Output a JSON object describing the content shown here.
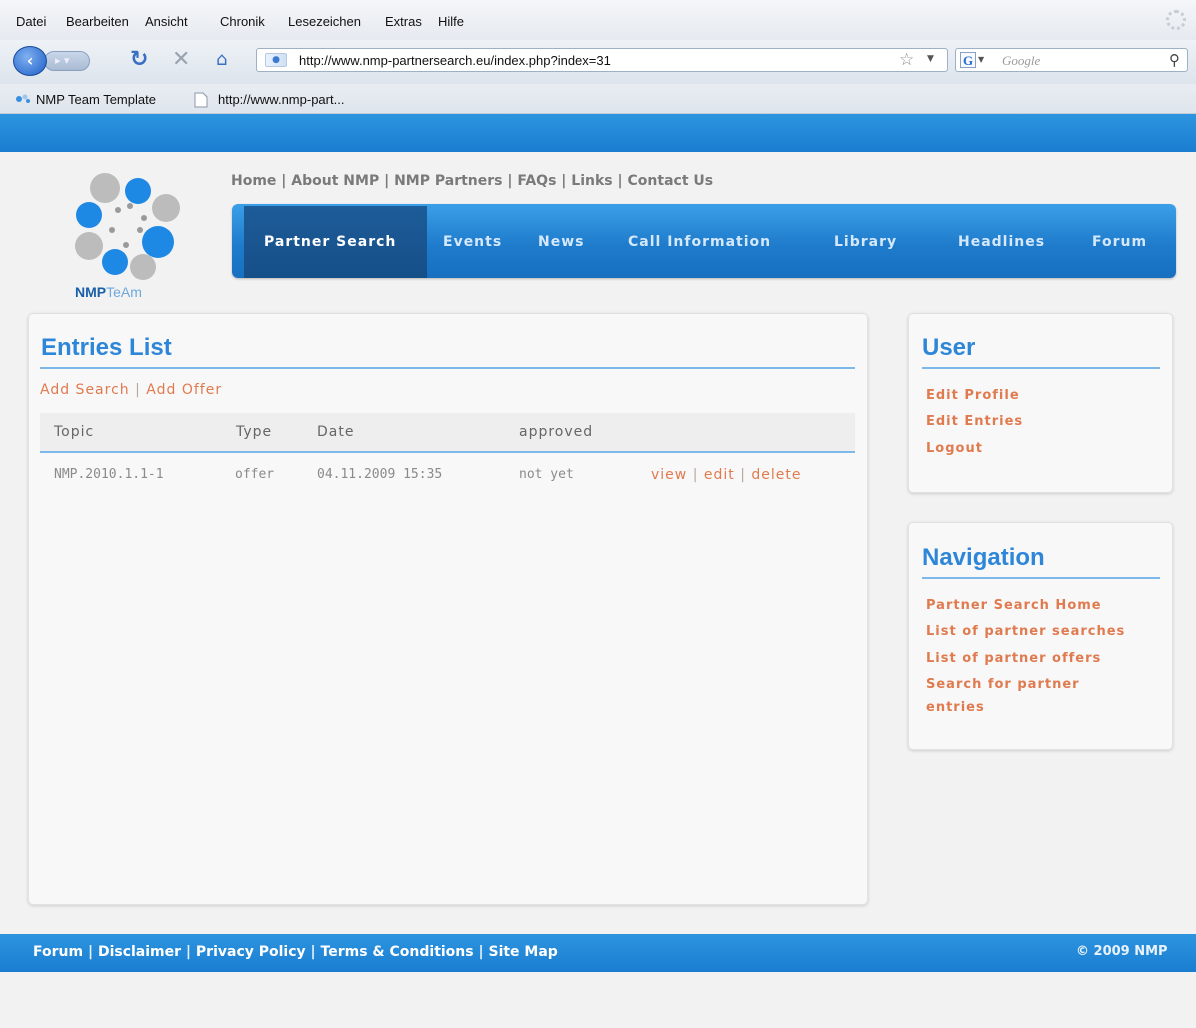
{
  "browser": {
    "menu": [
      "Datei",
      "Bearbeiten",
      "Ansicht",
      "Chronik",
      "Lesezeichen",
      "Extras",
      "Hilfe"
    ],
    "url": "http://www.nmp-partnersearch.eu/index.php?index=31",
    "search_placeholder": "Google",
    "search_engine_glyph": "G",
    "bookmarks": [
      "NMP Team Template",
      "http://www.nmp-part..."
    ],
    "icons": {
      "back": "back-arrow-icon",
      "forward": "forward-arrow-icon",
      "reload": "reload-icon",
      "stop": "stop-icon",
      "home": "home-icon",
      "bookmark_star": "star-icon",
      "search": "magnifier-icon"
    }
  },
  "site": {
    "logo_text_a": "NMP",
    "logo_text_b": "TeAm",
    "top_links": [
      "Home",
      "About NMP",
      "NMP Partners",
      "FAQs",
      "Links",
      "Contact Us"
    ],
    "separator": "|",
    "main_nav": [
      "Partner Search",
      "Events",
      "News",
      "Call Information",
      "Library",
      "Headlines",
      "Forum"
    ],
    "active_nav": "Partner Search"
  },
  "entries": {
    "title": "Entries List",
    "add_search": "Add Search",
    "add_offer": "Add Offer",
    "columns": [
      "Topic",
      "Type",
      "Date",
      "approved"
    ],
    "rows": [
      {
        "topic": "NMP.2010.1.1-1",
        "type": "offer",
        "date": "04.11.2009 15:35",
        "approved": "not yet",
        "actions": [
          "view",
          "edit",
          "delete"
        ]
      }
    ]
  },
  "user_box": {
    "title": "User",
    "links": [
      "Edit Profile",
      "Edit Entries",
      "Logout"
    ]
  },
  "navigation_box": {
    "title": "Navigation",
    "links": [
      "Partner Search Home",
      "List of partner searches",
      "List of partner offers",
      "Search for partner",
      "entries"
    ]
  },
  "footer": {
    "links": [
      "Forum",
      "Disclaimer",
      "Privacy Policy",
      "Terms & Conditions",
      "Site Map"
    ],
    "copyright": "© 2009 NMP"
  },
  "colors": {
    "brand_blue": "#1f7ccc",
    "link_orange": "#e07a4f",
    "title_blue": "#2d86d8"
  }
}
